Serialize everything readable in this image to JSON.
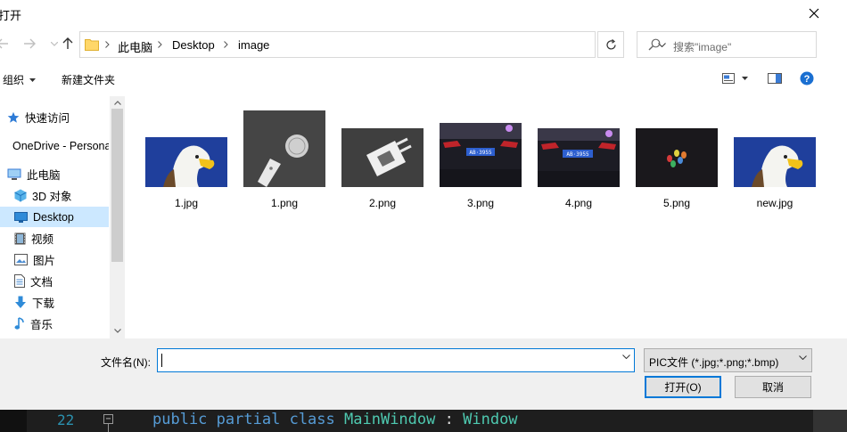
{
  "dialog": {
    "title": "打开",
    "close_glyph": "✕"
  },
  "address": {
    "breadcrumbs": [
      "此电脑",
      "Desktop",
      "image"
    ],
    "search_placeholder": "搜索\"image\""
  },
  "toolbar": {
    "organize": "组织",
    "new_folder": "新建文件夹"
  },
  "sidebar": {
    "items": [
      {
        "label": "快速访问",
        "icon": "star-icon"
      },
      {
        "label": "OneDrive - Personal",
        "icon": "cloud-icon"
      },
      {
        "label": "此电脑",
        "icon": "computer-icon"
      },
      {
        "label": "3D 对象",
        "icon": "cube-icon"
      },
      {
        "label": "Desktop",
        "icon": "desktop-icon",
        "selected": true
      },
      {
        "label": "视频",
        "icon": "video-icon"
      },
      {
        "label": "图片",
        "icon": "picture-icon"
      },
      {
        "label": "文档",
        "icon": "document-icon"
      },
      {
        "label": "下载",
        "icon": "download-icon"
      },
      {
        "label": "音乐",
        "icon": "music-icon"
      }
    ]
  },
  "files": [
    {
      "name": "1.jpg",
      "thumb": "eagle"
    },
    {
      "name": "1.png",
      "thumb": "coin"
    },
    {
      "name": "2.png",
      "thumb": "plug"
    },
    {
      "name": "3.png",
      "thumb": "car"
    },
    {
      "name": "4.png",
      "thumb": "car"
    },
    {
      "name": "5.png",
      "thumb": "beans"
    },
    {
      "name": "new.jpg",
      "thumb": "eagle"
    }
  ],
  "footer": {
    "filename_label": "文件名(N):",
    "filename_value": "",
    "filter": "PIC文件 (*.jpg;*.png;*.bmp)",
    "open_button": "打开(O)",
    "cancel_button": "取消"
  },
  "editor": {
    "line_number": "22",
    "fold_glyph": "−",
    "code_tokens": [
      "public",
      "partial",
      "class",
      "MainWindow",
      ":",
      "Window"
    ]
  },
  "colors": {
    "accent": "#0078d7",
    "selected_bg": "#cce8ff",
    "help": "#1a6fd1"
  }
}
